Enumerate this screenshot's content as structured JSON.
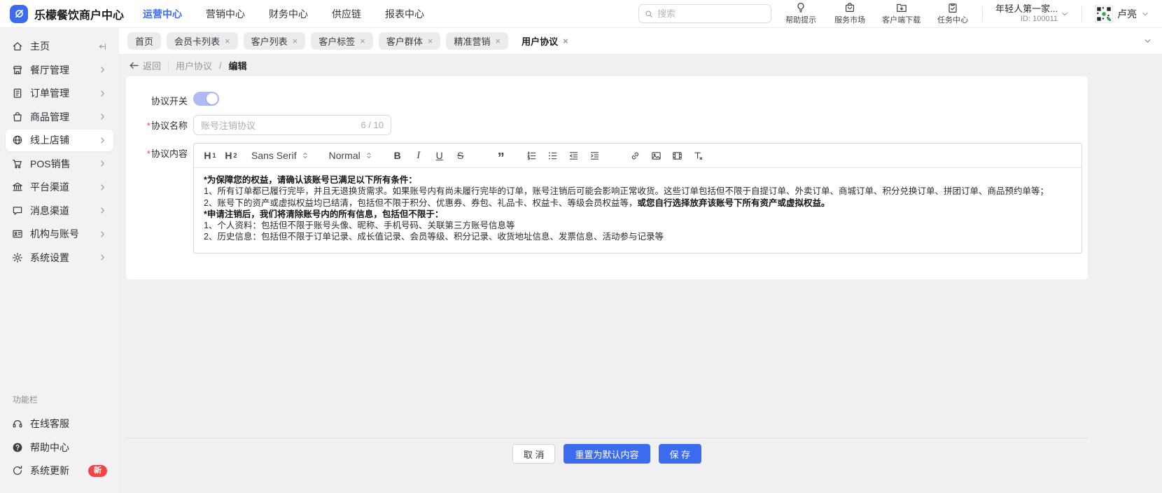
{
  "colors": {
    "primary": "#3D6BF0",
    "toggle_on": "#AFBAF4",
    "red": "#F24444"
  },
  "header": {
    "app_title": "乐檬餐饮商户中心",
    "nav": [
      {
        "key": "operations",
        "label": "运营中心",
        "active": true
      },
      {
        "key": "marketing",
        "label": "营销中心",
        "active": false
      },
      {
        "key": "finance",
        "label": "财务中心",
        "active": false
      },
      {
        "key": "supply-chain",
        "label": "供应链",
        "active": false
      },
      {
        "key": "reports",
        "label": "报表中心",
        "active": false
      }
    ],
    "search_placeholder": "搜索",
    "quick_actions": [
      {
        "key": "help-tips",
        "icon": "lightbulb-icon",
        "label": "帮助提示"
      },
      {
        "key": "service-market",
        "icon": "market-icon",
        "label": "服务市场"
      },
      {
        "key": "client-download",
        "icon": "download-icon",
        "label": "客户端下载"
      },
      {
        "key": "task-center",
        "icon": "task-icon",
        "label": "任务中心"
      }
    ],
    "account_name": "年轻人第一家...",
    "account_id": "ID: 100011",
    "user_name": "卢亮"
  },
  "sidebar": {
    "items": [
      {
        "key": "home",
        "icon": "home-icon",
        "label": "主页",
        "right": "collapse",
        "active": false
      },
      {
        "key": "restaurant",
        "icon": "restaurant-icon",
        "label": "餐厅管理",
        "right": "chevron",
        "active": false
      },
      {
        "key": "orders",
        "icon": "order-icon",
        "label": "订单管理",
        "right": "chevron",
        "active": false
      },
      {
        "key": "goods",
        "icon": "goods-icon",
        "label": "商品管理",
        "right": "chevron",
        "active": false
      },
      {
        "key": "online-store",
        "icon": "online-store-icon",
        "label": "线上店铺",
        "right": "chevron",
        "active": true
      },
      {
        "key": "pos",
        "icon": "pos-icon",
        "label": "POS销售",
        "right": "chevron",
        "active": false
      },
      {
        "key": "platform",
        "icon": "platform-icon",
        "label": "平台渠道",
        "right": "chevron",
        "active": false
      },
      {
        "key": "message",
        "icon": "message-icon",
        "label": "消息渠道",
        "right": "chevron",
        "active": false
      },
      {
        "key": "org-account",
        "icon": "org-icon",
        "label": "机构与账号",
        "right": "chevron",
        "active": false
      },
      {
        "key": "settings",
        "icon": "settings-icon",
        "label": "系统设置",
        "right": "chevron",
        "active": false
      }
    ],
    "section_title": "功能栏",
    "footer_items": [
      {
        "key": "online-service",
        "icon": "service-icon",
        "label": "在线客服",
        "badge": ""
      },
      {
        "key": "help-center",
        "icon": "help-icon",
        "label": "帮助中心",
        "badge": ""
      },
      {
        "key": "system-update",
        "icon": "update-icon",
        "label": "系统更新",
        "badge": "新"
      }
    ]
  },
  "tabs": [
    {
      "key": "home",
      "label": "首页",
      "closable": false,
      "active": false
    },
    {
      "key": "member-card-list",
      "label": "会员卡列表",
      "closable": true,
      "active": false
    },
    {
      "key": "customer-list",
      "label": "客户列表",
      "closable": true,
      "active": false
    },
    {
      "key": "customer-tags",
      "label": "客户标签",
      "closable": true,
      "active": false
    },
    {
      "key": "customer-groups",
      "label": "客户群体",
      "closable": true,
      "active": false
    },
    {
      "key": "precision-marketing",
      "label": "精准营销",
      "closable": true,
      "active": false
    },
    {
      "key": "user-agreement",
      "label": "用户协议",
      "closable": true,
      "active": true
    }
  ],
  "breadcrumb": {
    "back": "返回",
    "parent": "用户协议",
    "separator": "/",
    "current": "编辑"
  },
  "form": {
    "required_marker": "*",
    "switch_label": "协议开关",
    "switch_on": true,
    "name_label": "协议名称",
    "name_value": "账号注销协议",
    "name_counter": "6 / 10",
    "content_label": "协议内容"
  },
  "editor": {
    "toolbar": {
      "items": [
        {
          "key": "h1",
          "type": "htext",
          "label": "H1"
        },
        {
          "key": "h2",
          "type": "htext",
          "label": "H2"
        },
        {
          "key": "font-family",
          "type": "dropdown",
          "label": "Sans Serif"
        },
        {
          "key": "font-size",
          "type": "dropdown",
          "label": "Normal"
        },
        {
          "key": "bold",
          "type": "text",
          "label": "B"
        },
        {
          "key": "italic",
          "type": "text",
          "label": "I"
        },
        {
          "key": "underline",
          "type": "text",
          "label": "U"
        },
        {
          "key": "strike",
          "type": "text",
          "label": "S"
        },
        {
          "key": "blockquote",
          "type": "quote",
          "label": "”"
        },
        {
          "key": "ordered-list",
          "type": "icon",
          "icon": "ordered-list-icon"
        },
        {
          "key": "bullet-list",
          "type": "icon",
          "icon": "bullet-list-icon"
        },
        {
          "key": "outdent",
          "type": "icon",
          "icon": "outdent-icon"
        },
        {
          "key": "indent",
          "type": "icon",
          "icon": "indent-icon"
        },
        {
          "key": "link",
          "type": "icon",
          "icon": "link-icon"
        },
        {
          "key": "image",
          "type": "icon",
          "icon": "image-icon"
        },
        {
          "key": "video",
          "type": "icon",
          "icon": "video-icon"
        },
        {
          "key": "clear-format",
          "type": "icon",
          "icon": "clear-format-icon"
        }
      ]
    },
    "lines": [
      {
        "segments": [
          {
            "text": "*为保障您的权益，请确认该账号已满足以下所有条件：",
            "bold": true
          }
        ]
      },
      {
        "segments": [
          {
            "text": "1、所有订单都已履行完毕，并且无退换货需求。如果账号内有尚未履行完毕的订单，账号注销后可能会影响正常收货。这些订单包括但不限于自提订单、外卖订单、商城订单、积分兑换订单、拼团订单、商品预约单等；",
            "bold": false
          }
        ]
      },
      {
        "segments": [
          {
            "text": "2、账号下的资产或虚拟权益均已结清，包括但不限于积分、优惠券、券包、礼品卡、权益卡、等级会员权益等，",
            "bold": false
          },
          {
            "text": "或您自行选择放弃该账号下所有资产或虚拟权益。",
            "bold": true
          }
        ]
      },
      {
        "segments": [
          {
            "text": "*申请注销后，我们将清除账号内的所有信息，包括但不限于：",
            "bold": true
          }
        ]
      },
      {
        "segments": [
          {
            "text": "1、个人资料：包括但不限于账号头像、昵称、手机号码、关联第三方账号信息等",
            "bold": false
          }
        ]
      },
      {
        "segments": [
          {
            "text": "2、历史信息：包括但不限于订单记录、成长值记录、会员等级、积分记录、收货地址信息、发票信息、活动参与记录等",
            "bold": false
          }
        ]
      }
    ]
  },
  "footer": {
    "cancel_label": "取 消",
    "reset_label": "重置为默认内容",
    "save_label": "保 存"
  }
}
